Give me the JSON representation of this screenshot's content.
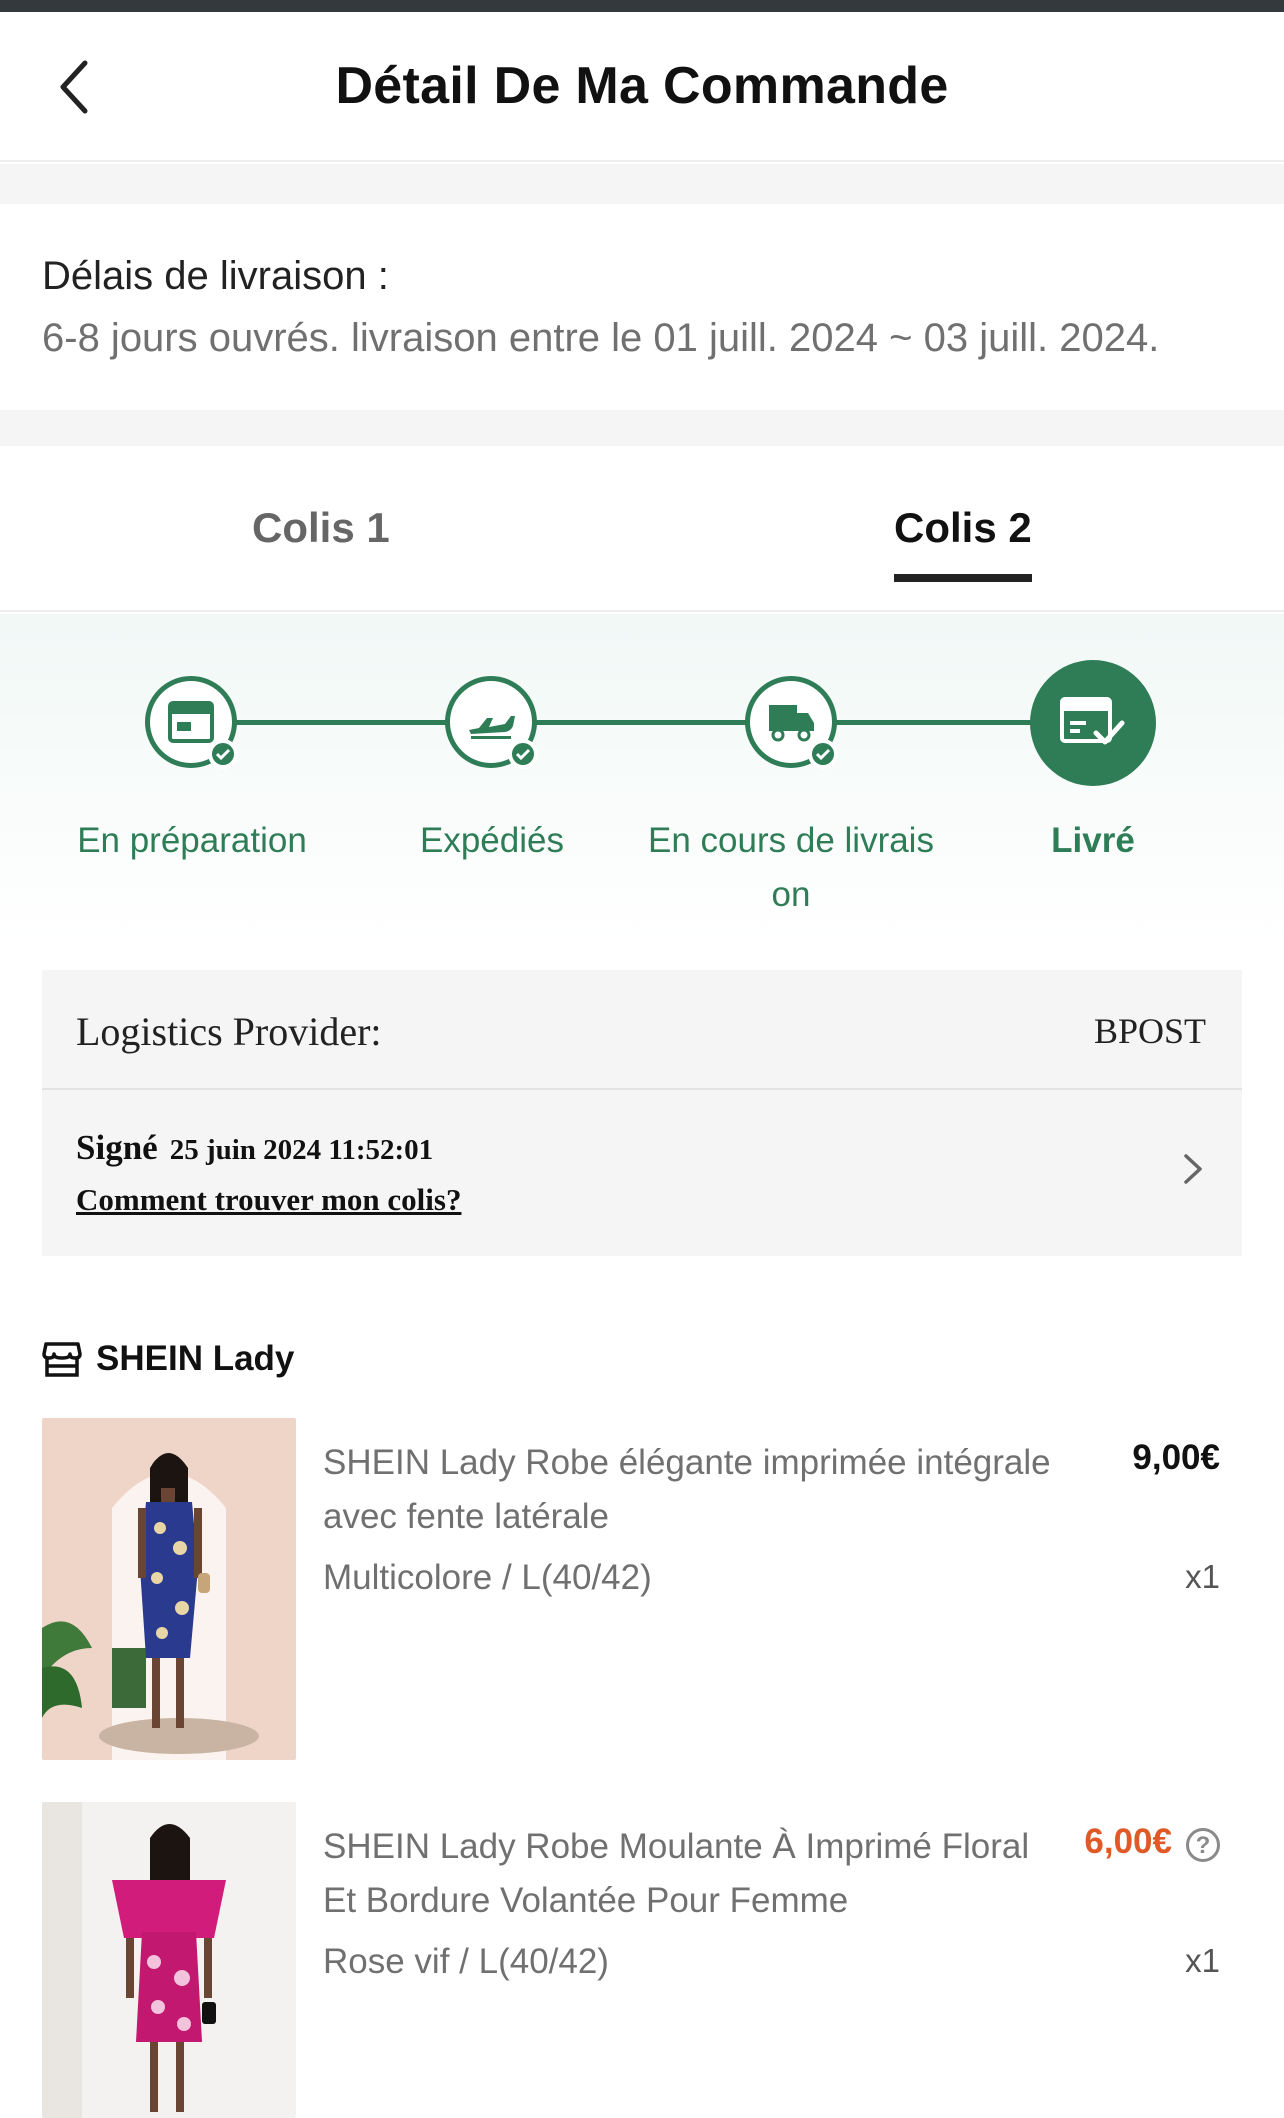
{
  "header": {
    "title": "Détail De Ma Commande",
    "back_icon": "chevron-left-icon"
  },
  "delivery": {
    "label": "Délais de livraison :",
    "text": "6-8 jours ouvrés. livraison entre le 01 juill. 2024 ~ 03 juill. 2024."
  },
  "tabs": [
    {
      "label": "Colis 1",
      "active": false
    },
    {
      "label": "Colis 2",
      "active": true
    }
  ],
  "progress": {
    "accent": "#2e7d57",
    "steps": [
      {
        "label": "En préparation",
        "icon": "package-icon",
        "done": true
      },
      {
        "label": "Expédiés",
        "icon": "airplane-icon",
        "done": true
      },
      {
        "label_line1": "En cours de livrais",
        "label_line2": "on",
        "icon": "truck-icon",
        "done": true
      },
      {
        "label": "Livré",
        "icon": "box-check-icon",
        "current": true
      }
    ]
  },
  "logistics": {
    "provider_label": "Logistics Provider:",
    "provider_value": "BPOST",
    "status": "Signé",
    "status_datetime": "25 juin 2024 11:52:01",
    "help_link": "Comment trouver mon colis?"
  },
  "store": {
    "icon": "store-icon",
    "name": "SHEIN Lady"
  },
  "products": [
    {
      "title": "SHEIN Lady Robe élégante imprimée intégrale avec fente latérale",
      "price": "9,00€",
      "variant": "Multicolore / L(40/42)",
      "quantity": "x1",
      "dress_color": "#2a3b8f"
    },
    {
      "title": "SHEIN Lady Robe Moulante À Imprimé Floral Et Bordure Volantée Pour Femme",
      "price": "6,00€",
      "price_color": "#e05a27",
      "help_icon": "question-circle-icon",
      "variant": "Rose vif / L(40/42)",
      "quantity": "x1",
      "dress_color": "#d11c7c"
    }
  ]
}
